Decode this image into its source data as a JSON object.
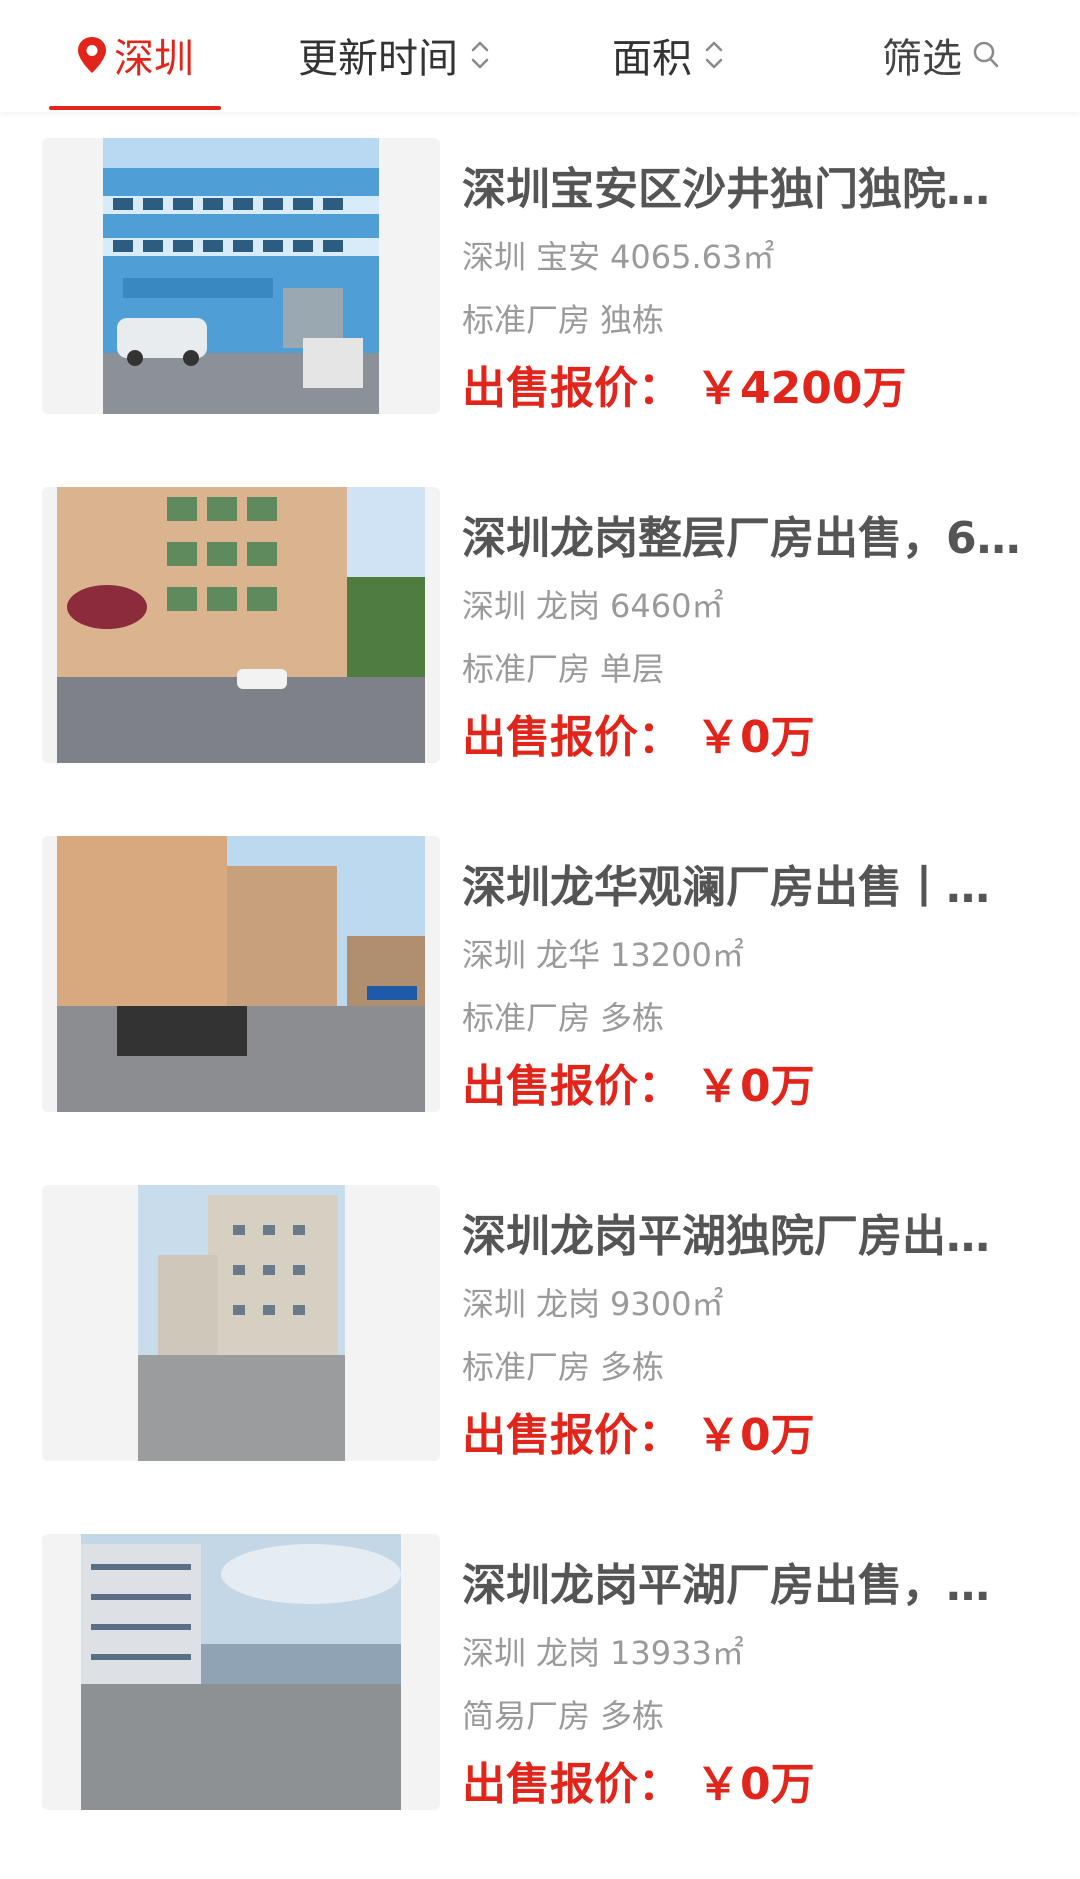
{
  "colors": {
    "accent": "#e1251b",
    "title_text": "#555555",
    "meta_text": "#9a9a9a",
    "tab_text": "#333333"
  },
  "filter_bar": {
    "city": {
      "label": "深圳",
      "icon": "location-pin-icon"
    },
    "sort_update": {
      "label": "更新时间",
      "icon": "sort-chevron-icon"
    },
    "sort_area": {
      "label": "面积",
      "icon": "sort-chevron-icon"
    },
    "filter": {
      "label": "筛选",
      "icon": "search-icon"
    }
  },
  "listings": [
    {
      "title": "深圳宝安区沙井独门独院…",
      "city": "深圳",
      "district": "宝安",
      "area": "4065.63㎡",
      "type": "标准厂房",
      "building": "独栋",
      "price_label": "出售报价：",
      "price": "￥4200万"
    },
    {
      "title": "深圳龙岗整层厂房出售，6…",
      "city": "深圳",
      "district": "龙岗",
      "area": "6460㎡",
      "type": "标准厂房",
      "building": "单层",
      "price_label": "出售报价：",
      "price": "￥0万"
    },
    {
      "title": "深圳龙华观澜厂房出售丨…",
      "city": "深圳",
      "district": "龙华",
      "area": "13200㎡",
      "type": "标准厂房",
      "building": "多栋",
      "price_label": "出售报价：",
      "price": "￥0万"
    },
    {
      "title": "深圳龙岗平湖独院厂房出…",
      "city": "深圳",
      "district": "龙岗",
      "area": "9300㎡",
      "type": "标准厂房",
      "building": "多栋",
      "price_label": "出售报价：",
      "price": "￥0万"
    },
    {
      "title": "深圳龙岗平湖厂房出售，…",
      "city": "深圳",
      "district": "龙岗",
      "area": "13933㎡",
      "type": "简易厂房",
      "building": "多栋",
      "price_label": "出售报价：",
      "price": "￥0万"
    }
  ]
}
